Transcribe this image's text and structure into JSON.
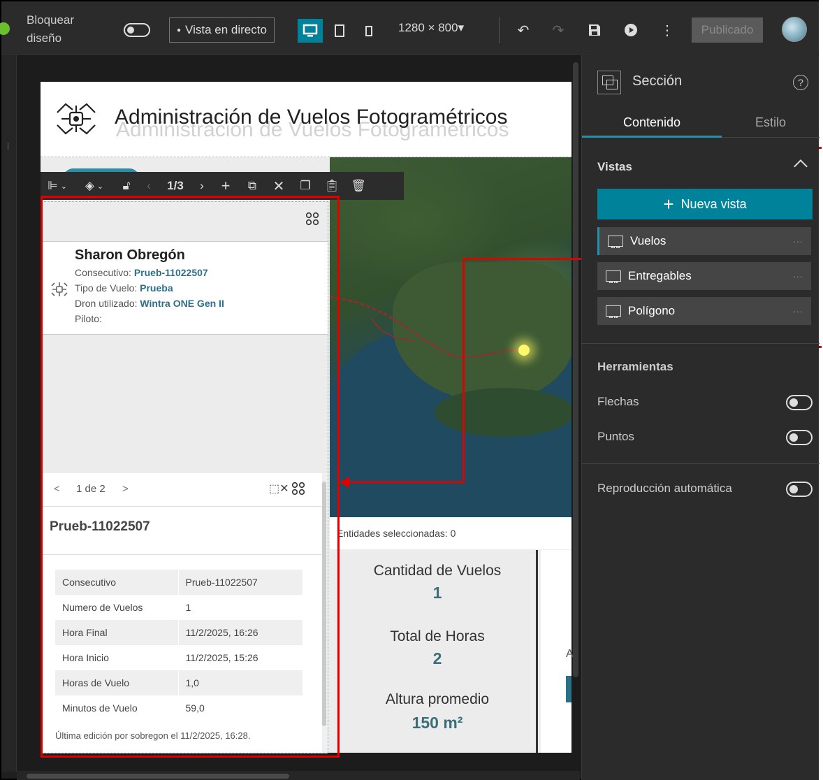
{
  "topbar": {
    "lock_label": "Bloquear diseño",
    "live_view_label": "Vista en directo",
    "resolution": "1280 × 800",
    "published_label": "Publicado"
  },
  "page": {
    "title": "Administración de Vuelos Fotogramétricos",
    "map_status": "Entidades seleccionadas: 0",
    "stats": [
      {
        "label": "Cantidad de Vuelos",
        "value": "1"
      },
      {
        "label": "Total de Horas",
        "value": "2"
      },
      {
        "label": "Altura promedio",
        "value": "150 m²"
      }
    ],
    "right_fragment_text": "A"
  },
  "widget_toolbar": {
    "page_indicator": "1/3"
  },
  "widget_panel": {
    "card": {
      "name": "Sharon Obregón",
      "consecutivo_label": "Consecutivo:",
      "consecutivo_value": "Prueb-11022507",
      "tipo_label": "Tipo de Vuelo:",
      "tipo_value": "Prueba",
      "dron_label": "Dron utilizado:",
      "dron_value": "Wintra ONE Gen II",
      "piloto_label": "Piloto:"
    },
    "pager": {
      "prev": "<",
      "text": "1 de 2",
      "next": ">"
    },
    "record": {
      "title": "Prueb-11022507",
      "rows": [
        {
          "field": "Consecutivo",
          "value": "Prueb-11022507"
        },
        {
          "field": "Numero de Vuelos",
          "value": "1"
        },
        {
          "field": "Hora Final",
          "value": "11/2/2025, 16:26"
        },
        {
          "field": "Hora Inicio",
          "value": "11/2/2025, 15:26"
        },
        {
          "field": "Horas de Vuelo",
          "value": "1,0"
        },
        {
          "field": "Minutos de Vuelo",
          "value": "59,0"
        }
      ],
      "last_edit": "Última edición por sobregon el 11/2/2025, 16:28."
    }
  },
  "settings_panel": {
    "title": "Sección",
    "tabs": [
      "Contenido",
      "Estilo"
    ],
    "views_heading": "Vistas",
    "new_view_label": "Nueva vista",
    "views": [
      "Vuelos",
      "Entregables",
      "Polígono"
    ],
    "tools_heading": "Herramientas",
    "arrows_label": "Flechas",
    "points_label": "Puntos",
    "autoplay_label": "Reproducción automática"
  },
  "colors": {
    "accent": "#00829b",
    "annotation_red": "#e00000",
    "stat_value": "#3b6f78"
  }
}
